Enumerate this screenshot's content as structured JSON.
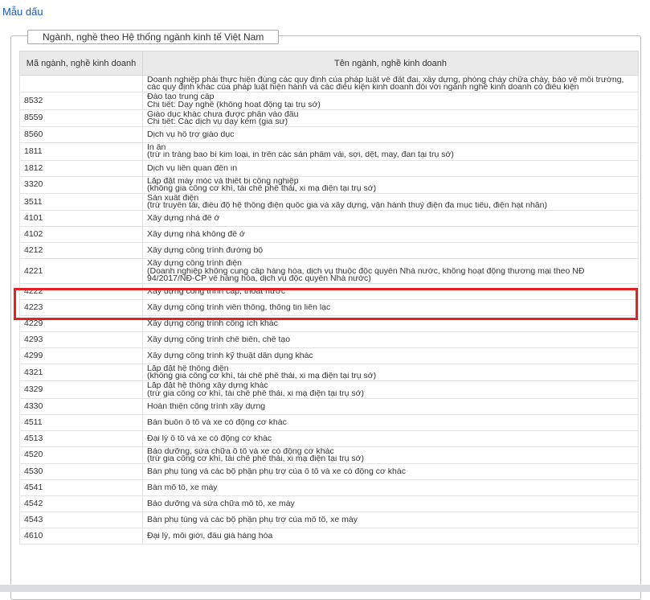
{
  "header": {
    "link_label": "Mẫu dấu"
  },
  "panel": {
    "legend": "Ngành, nghề theo Hệ thống ngành kinh tế Việt Nam"
  },
  "table": {
    "columns": [
      "Mã ngành, nghề kinh doanh",
      "Tên ngành, nghề kinh doanh"
    ],
    "rows": [
      {
        "code": "",
        "lines": [
          "Doanh nghiệp phải thực hiện đúng các quy định của pháp luật về đất đai, xây dựng, phòng cháy chữa cháy, bảo vệ môi trường,",
          "các quy định khác của pháp luật hiện hành và các điều kiện kinh doanh đối với ngành nghề kinh doanh có điều kiện"
        ]
      },
      {
        "code": "8532",
        "lines": [
          "Đào tạo trung cấp",
          "Chi tiết: Dạy nghề (không hoạt động tại trụ sở)"
        ]
      },
      {
        "code": "8559",
        "lines": [
          "Giáo dục khác chưa được phân vào đâu",
          "Chi tiết: Các dịch vụ dạy kèm (gia sư)"
        ]
      },
      {
        "code": "8560",
        "lines": [
          "Dịch vụ hỗ trợ giáo dục"
        ]
      },
      {
        "code": "1811",
        "lines": [
          "In ấn",
          "(trừ in tráng bao bì kim loại, in trên các sản phẩm vải, sợi, dệt, may, đan tại trụ sở)"
        ]
      },
      {
        "code": "1812",
        "lines": [
          "Dịch vụ liên quan đến in"
        ]
      },
      {
        "code": "3320",
        "lines": [
          "Lắp đặt máy móc và thiết bị công nghiệp",
          "(không gia công cơ khí, tái chế phế thải, xi mạ điện tại trụ sở)"
        ]
      },
      {
        "code": "3511",
        "lines": [
          "Sản xuất điện",
          "(trừ truyền tải, điều độ hệ thống điện quốc gia và xây dựng, vận hành thuỷ điện đa mục tiêu, điện hạt nhân)"
        ]
      },
      {
        "code": "4101",
        "lines": [
          "Xây dựng nhà để ở"
        ]
      },
      {
        "code": "4102",
        "lines": [
          "Xây dựng nhà không để ở"
        ]
      },
      {
        "code": "4212",
        "lines": [
          "Xây dựng công trình đường bộ"
        ]
      },
      {
        "code": "4221",
        "lines": [
          "Xây dựng công trình điện",
          "(Doanh nghiệp không cung cấp hàng hóa, dịch vụ thuộc độc quyền Nhà nước, không hoạt động thương mại theo NĐ",
          "94/2017/NĐ-CP về hàng hóa, dịch vụ độc quyền Nhà nước)"
        ]
      },
      {
        "code": "4222",
        "lines": [
          "Xây dựng công trình cấp, thoát nước"
        ]
      },
      {
        "code": "4223",
        "lines": [
          "Xây dựng công trình viễn thông, thông tin liên lạc"
        ]
      },
      {
        "code": "4229",
        "lines": [
          "Xây dựng công trình công ích khác"
        ]
      },
      {
        "code": "4293",
        "lines": [
          "Xây dựng công trình chế biến, chế tạo"
        ]
      },
      {
        "code": "4299",
        "lines": [
          "Xây dựng công trình kỹ thuật dân dụng khác"
        ]
      },
      {
        "code": "4321",
        "lines": [
          "Lắp đặt hệ thống điện",
          "(không gia công cơ khí, tái chế phế thải, xi mạ điện tại trụ sở)"
        ]
      },
      {
        "code": "4329",
        "lines": [
          "Lắp đặt hệ thống xây dựng khác",
          "(trừ gia công cơ khí, tái chế phế thải, xi mạ điện tại trụ sở)"
        ]
      },
      {
        "code": "4330",
        "lines": [
          "Hoàn thiện công trình xây dựng"
        ]
      },
      {
        "code": "4511",
        "lines": [
          "Bán buôn ô tô và xe có động cơ khác"
        ]
      },
      {
        "code": "4513",
        "lines": [
          "Đại lý ô tô và xe có động cơ khác"
        ]
      },
      {
        "code": "4520",
        "lines": [
          "Bảo dưỡng, sửa chữa ô tô và xe có động cơ khác",
          "(trừ gia công cơ khí, tái chế phế thải, xi mạ điện tại trụ sở)"
        ]
      },
      {
        "code": "4530",
        "lines": [
          "Bán phụ tùng và các bộ phận phụ trợ của ô tô và xe có động cơ khác"
        ]
      },
      {
        "code": "4541",
        "lines": [
          "Bán mô tô, xe máy"
        ]
      },
      {
        "code": "4542",
        "lines": [
          "Bảo dưỡng và sửa chữa mô tô, xe máy"
        ]
      },
      {
        "code": "4543",
        "lines": [
          "Bán phụ tùng và các bộ phận phụ trợ của mô tô, xe máy"
        ]
      },
      {
        "code": "4610",
        "lines": [
          "Đại lý, môi giới, đấu giá hàng hóa"
        ]
      }
    ]
  },
  "highlight": {
    "code": "4221",
    "color": "#e32222"
  }
}
